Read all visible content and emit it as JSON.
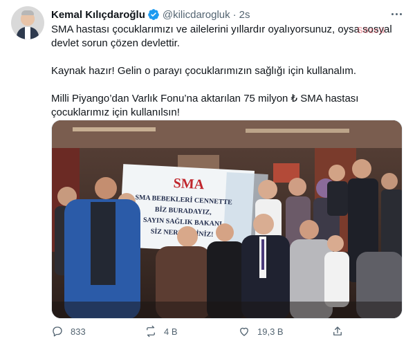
{
  "tweet": {
    "author_name": "Kemal Kılıçdaroğlu",
    "handle": "@kilicdarogluk",
    "separator": "·",
    "time": "2s",
    "paragraphs": [
      "SMA hastası çocuklarımızı ve ailelerini yıllardır oyalıyorsunuz, oysa sosyal devlet sorun çözen devlettir.",
      "Kaynak hazır! Gelin o parayı çocuklarımızın sağlığı için kullanalım.",
      "Milli Piyango’dan Varlık Fonu’na aktarılan 75 milyon ₺ SMA hastası çocuklarımız için kullanılsın!"
    ],
    "watermark": "Sözcü",
    "banner": {
      "title": "SMA",
      "line1": "SMA BEBEKLERİ CENNETTE",
      "line2": "BİZ BURADAYIZ,",
      "line3": "SAYIN SAĞLIK BAKANI",
      "line4": "SİZ NEREDESİNİZ!"
    }
  },
  "actions": {
    "replies": "833",
    "retweets": "4 B",
    "likes": "19,3 B"
  },
  "icons": {
    "verified": "verified-badge-icon",
    "more": "more-horizontal-icon",
    "reply": "reply-icon",
    "retweet": "retweet-icon",
    "like": "heart-icon",
    "share": "share-icon"
  },
  "colors": {
    "text": "#0f1419",
    "secondary": "#536471",
    "verified": "#1d9bf0"
  }
}
